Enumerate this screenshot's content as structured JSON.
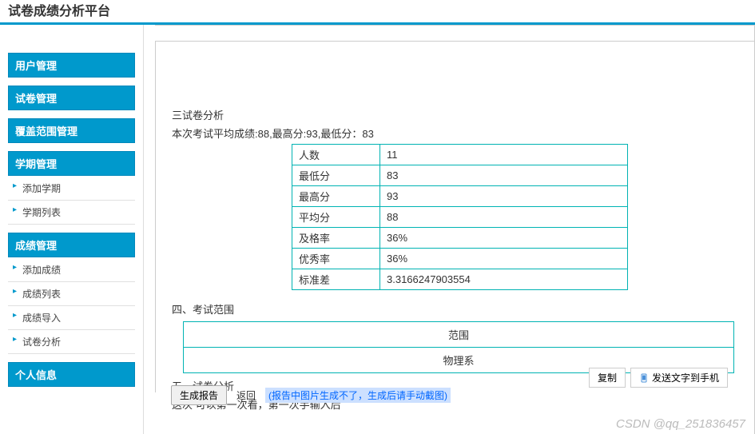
{
  "header": {
    "title_fragment": "试卷成绩分析平台"
  },
  "sidebar": {
    "groups": [
      {
        "header": "用户管理",
        "items": []
      },
      {
        "header": "试卷管理",
        "items": []
      },
      {
        "header": "覆盖范围管理",
        "items": []
      },
      {
        "header": "学期管理",
        "items": [
          "添加学期",
          "学期列表"
        ]
      },
      {
        "header": "成绩管理",
        "items": [
          "添加成绩",
          "成绩列表",
          "成绩导入",
          "试卷分析"
        ]
      },
      {
        "header": "个人信息",
        "items": []
      }
    ]
  },
  "content": {
    "section3_title": "三试卷分析",
    "summary": "本次考试平均成绩:88,最高分:93,最低分：83",
    "stats": [
      {
        "label": "人数",
        "value": "11"
      },
      {
        "label": "最低分",
        "value": "83"
      },
      {
        "label": "最高分",
        "value": "93"
      },
      {
        "label": "平均分",
        "value": "88"
      },
      {
        "label": "及格率",
        "value": "36%"
      },
      {
        "label": "优秀率",
        "value": "36%"
      },
      {
        "label": "标准差",
        "value": "3.3166247903554"
      }
    ],
    "section4_title": "四、考试范围",
    "scope": {
      "header": "范围",
      "value": "物理系"
    },
    "section5_title": "五、试卷分析",
    "section5_text": "这次 可以第一次看，第一次手输入后"
  },
  "buttons": {
    "generate": "生成报告",
    "back": "返回",
    "hint": "(报告中图片生成不了，生成后请手动截图)",
    "copy": "复制",
    "send_phone": "发送文字到手机"
  },
  "watermark": "CSDN @qq_251836457"
}
